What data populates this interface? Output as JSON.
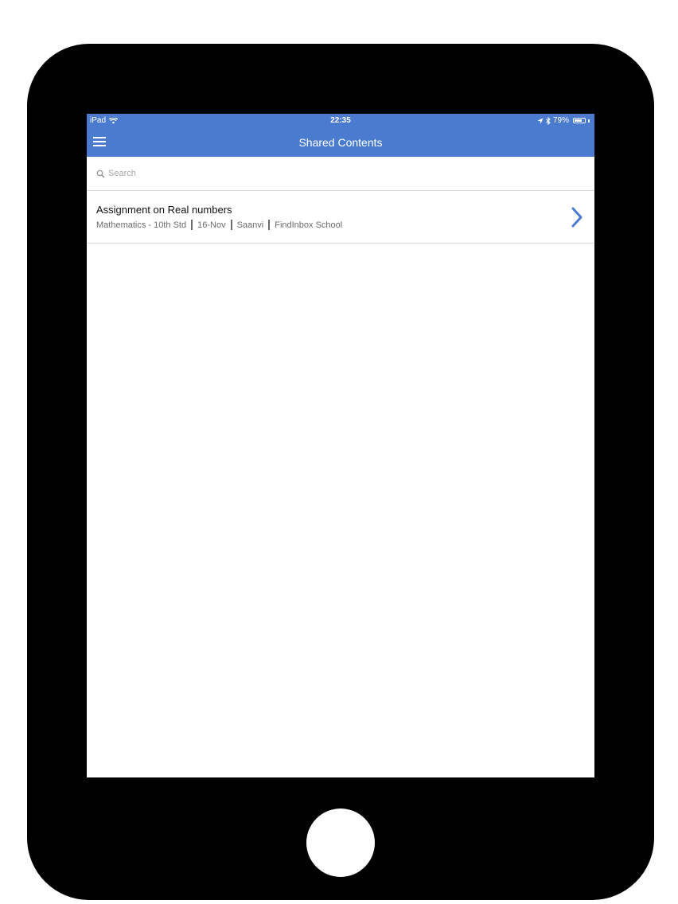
{
  "status_bar": {
    "device": "iPad",
    "time": "22:35",
    "battery_percent": "79%",
    "battery_level": 0.79,
    "icons": [
      "wifi-icon",
      "location-icon",
      "bluetooth-icon",
      "battery-icon"
    ]
  },
  "nav": {
    "title": "Shared Contents",
    "menu_icon": "hamburger-menu-icon"
  },
  "search": {
    "placeholder": "Search",
    "value": "",
    "icon": "search-icon"
  },
  "items": [
    {
      "title": "Assignment on Real numbers",
      "subject": "Mathematics - 10th Std",
      "date": "16-Nov",
      "student": "Saanvi",
      "school": "FindInbox School"
    }
  ],
  "colors": {
    "accent": "#4a7bcf",
    "chevron": "#4a7bcf",
    "device_frame": "#000000"
  }
}
